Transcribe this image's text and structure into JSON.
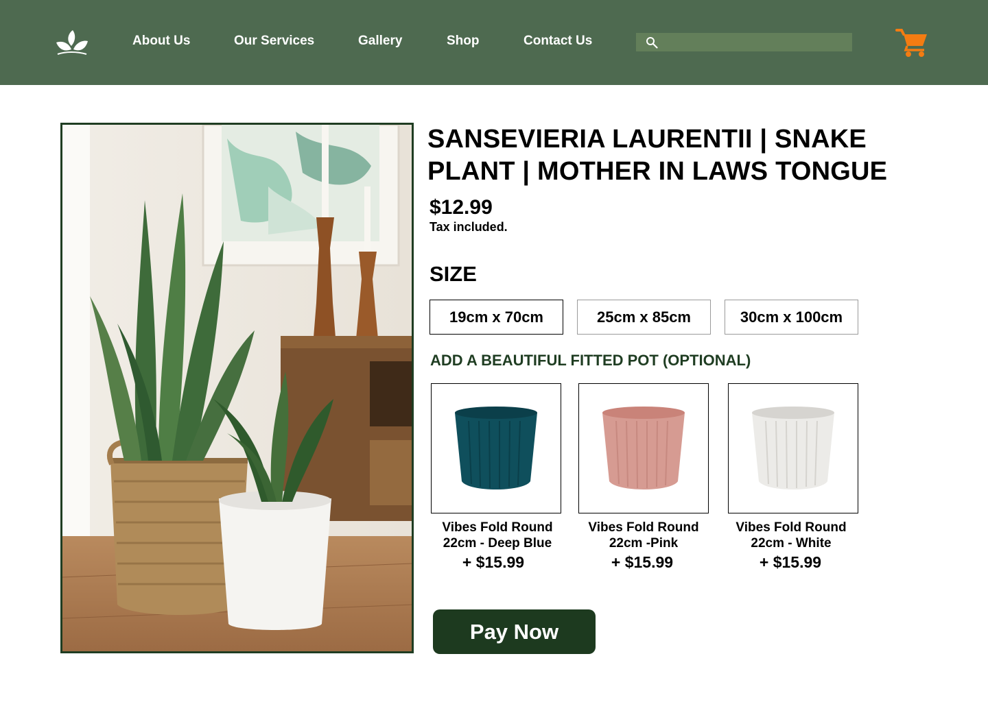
{
  "nav": {
    "links": [
      "About Us",
      "Our Services",
      "Gallery",
      "Shop",
      "Contact Us"
    ],
    "search_placeholder": ""
  },
  "product": {
    "title": "SANSEVIERIA LAURENTII | SNAKE PLANT | MOTHER IN LAWS TONGUE",
    "price": "$12.99",
    "tax_note": "Tax included.",
    "size_heading": "SIZE",
    "sizes": [
      "19cm x 70cm",
      "25cm x 85cm",
      "30cm x 100cm"
    ],
    "selected_size": "19cm x 70cm"
  },
  "pots": {
    "heading": "ADD A BEAUTIFUL FITTED POT (OPTIONAL)",
    "items": [
      {
        "name_line1": "Vibes Fold Round",
        "name_line2": "22cm - Deep Blue",
        "price": "+ $15.99",
        "color": "#0f4f5c"
      },
      {
        "name_line1": "Vibes Fold Round",
        "name_line2": "22cm -Pink",
        "price": "+ $15.99",
        "color": "#d69b92"
      },
      {
        "name_line1": "Vibes Fold Round",
        "name_line2": "22cm - White",
        "price": "+ $15.99",
        "color": "#e9e7e3"
      }
    ]
  },
  "checkout": {
    "pay_label": "Pay Now"
  },
  "colors": {
    "header": "#4e6a50",
    "accent_dark": "#1d3a1f",
    "cart": "#f47c12"
  },
  "icons": {
    "logo": "leaf-logo-icon",
    "search": "search-icon",
    "cart": "cart-icon"
  }
}
